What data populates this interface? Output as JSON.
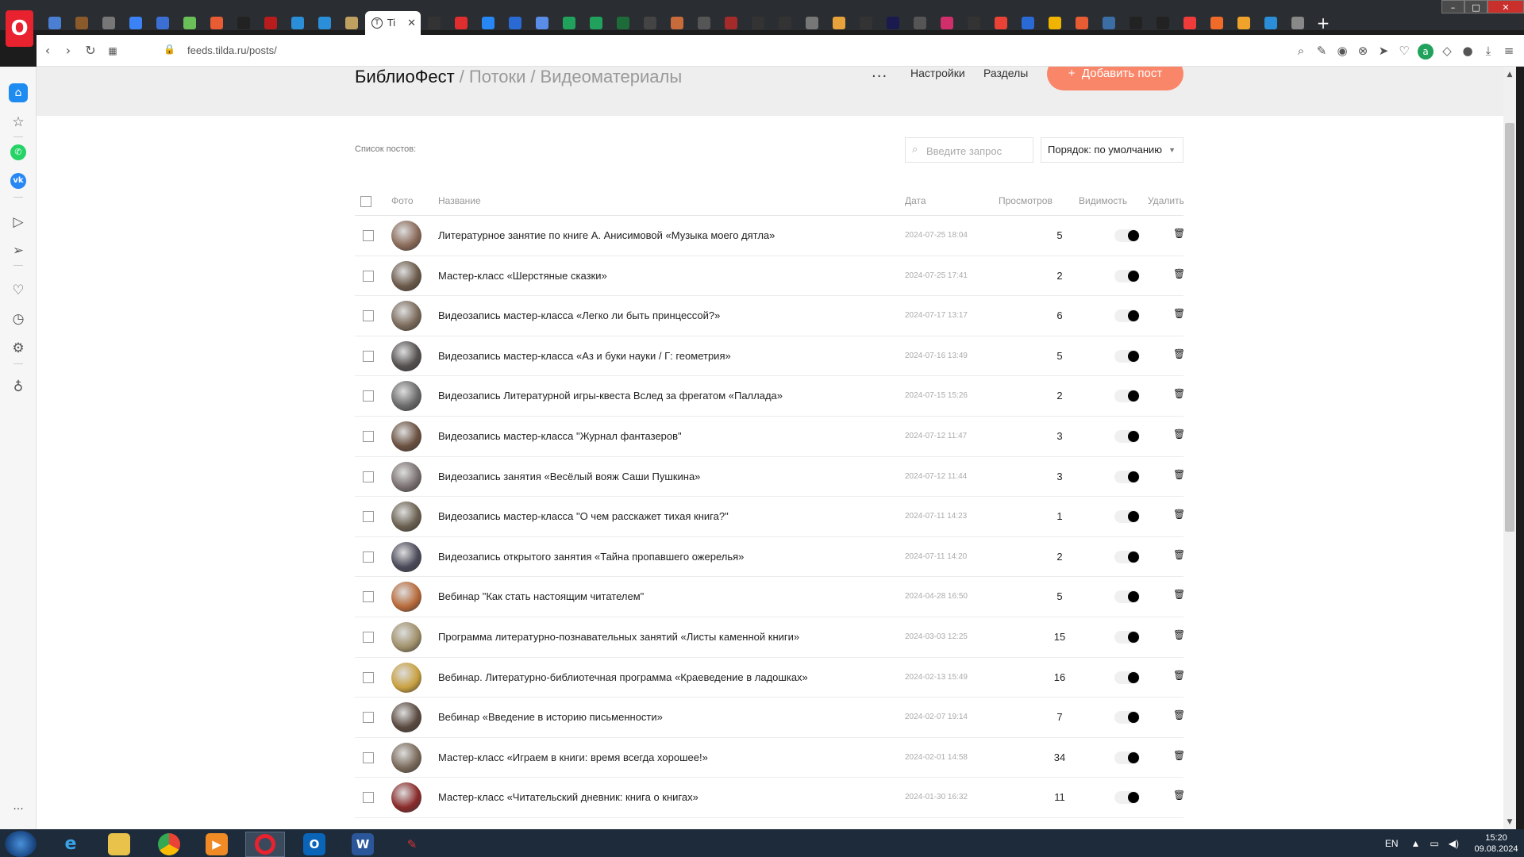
{
  "browser": {
    "active_tab": {
      "label": "Ti"
    },
    "url": "feeds.tilda.ru/posts/",
    "logo_letter": "O"
  },
  "tabs_icons": [
    {
      "name": "tab-1-icon",
      "color": "#4a7fd4"
    },
    {
      "name": "tab-2-icon",
      "color": "#8a5a2b"
    },
    {
      "name": "tab-3-icon",
      "color": "#777777"
    },
    {
      "name": "tab-4-icon",
      "color": "#3b82f6"
    },
    {
      "name": "tab-5-icon",
      "color": "#3b6fd4"
    },
    {
      "name": "tab-6-icon",
      "color": "#6bbf59"
    },
    {
      "name": "tab-7-icon",
      "color": "#e85c33"
    },
    {
      "name": "tab-8-icon",
      "color": "#222222"
    },
    {
      "name": "tab-9-icon",
      "color": "#b91c1c"
    },
    {
      "name": "tab-10-icon",
      "color": "#2a8fd8"
    },
    {
      "name": "tab-11-icon",
      "color": "#2a8fd8"
    },
    {
      "name": "tab-12-icon",
      "color": "#c0a060"
    }
  ],
  "tabs_icons_right": [
    {
      "name": "tab-14-icon",
      "color": "#333333"
    },
    {
      "name": "tab-15-icon",
      "color": "#e02d2d"
    },
    {
      "name": "tab-16-icon",
      "color": "#2787f5"
    },
    {
      "name": "tab-17-icon",
      "color": "#2a6ad4"
    },
    {
      "name": "tab-18-icon",
      "color": "#5a8de8"
    },
    {
      "name": "tab-19-icon",
      "color": "#21a25c"
    },
    {
      "name": "tab-20-icon",
      "color": "#21a25c"
    },
    {
      "name": "tab-21-icon",
      "color": "#1e6b3a"
    },
    {
      "name": "tab-22-icon",
      "color": "#444444"
    },
    {
      "name": "tab-23-icon",
      "color": "#c86b3b"
    },
    {
      "name": "tab-24-icon",
      "color": "#555555"
    },
    {
      "name": "tab-25-icon",
      "color": "#a52a2a"
    },
    {
      "name": "tab-26-icon",
      "color": "#333333"
    },
    {
      "name": "tab-27-icon",
      "color": "#333333"
    },
    {
      "name": "tab-28-icon",
      "color": "#777777"
    },
    {
      "name": "tab-29-icon",
      "color": "#e8a23b"
    },
    {
      "name": "tab-30-icon",
      "color": "#333333"
    },
    {
      "name": "tab-31-icon",
      "color": "#1a1a4e"
    },
    {
      "name": "tab-32-icon",
      "color": "#555555"
    },
    {
      "name": "tab-33-icon",
      "color": "#d12f6b"
    },
    {
      "name": "tab-34-icon",
      "color": "#333333"
    },
    {
      "name": "tab-35-icon",
      "color": "#ea4335"
    },
    {
      "name": "tab-36-icon",
      "color": "#2a6ad4"
    },
    {
      "name": "tab-37-icon",
      "color": "#f0b400"
    },
    {
      "name": "tab-38-icon",
      "color": "#e85c33"
    },
    {
      "name": "tab-39-icon",
      "color": "#3a6ea5"
    },
    {
      "name": "tab-40-icon",
      "color": "#222222"
    },
    {
      "name": "tab-41-icon",
      "color": "#222222"
    },
    {
      "name": "tab-42-icon",
      "color": "#f03b3b"
    },
    {
      "name": "tab-43-icon",
      "color": "#f06a2a"
    },
    {
      "name": "tab-44-icon",
      "color": "#f0a32a"
    },
    {
      "name": "tab-45-icon",
      "color": "#2a8fd8"
    },
    {
      "name": "tab-46-icon",
      "color": "#888888"
    }
  ],
  "page": {
    "breadcrumb": [
      "БиблиоФест",
      "Потоки",
      "Видеоматериалы"
    ],
    "settings_link": "Настройки",
    "sections_link": "Разделы",
    "add_button": "Добавить пост",
    "list_label": "Список постов:",
    "search_placeholder": "Введите запрос",
    "order_value": "Порядок: по умолчанию",
    "columns": {
      "photo": "Фото",
      "title": "Название",
      "date": "Дата",
      "views": "Просмотров",
      "visibility": "Видимость",
      "delete": "Удалить"
    }
  },
  "posts": [
    {
      "title": "Литературное занятие по книге А. Анисимовой «Музыка моего дятла»",
      "date": "2024-07-25 18:04",
      "views": "5",
      "thumb": "#8a6a58"
    },
    {
      "title": "Мастер-класс «Шерстяные сказки»",
      "date": "2024-07-25 17:41",
      "views": "2",
      "thumb": "#6b5a4a"
    },
    {
      "title": "Видеозапись мастер-класса «Легко ли быть принцессой?»",
      "date": "2024-07-17 13:17",
      "views": "6",
      "thumb": "#7a6a5a"
    },
    {
      "title": "Видеозапись мастер-класса «Аз и буки науки / Г: геометрия»",
      "date": "2024-07-16 13:49",
      "views": "5",
      "thumb": "#555050"
    },
    {
      "title": "Видеозапись Литературной игры-квеста Вслед за фрегатом «Паллада»",
      "date": "2024-07-15 15:26",
      "views": "2",
      "thumb": "#6a6a6a"
    },
    {
      "title": "Видеозапись мастер-класса \"Журнал фантазеров\"",
      "date": "2024-07-12 11:47",
      "views": "3",
      "thumb": "#6a5040"
    },
    {
      "title": "Видеозапись занятия «Весёлый вояж Саши Пушкина»",
      "date": "2024-07-12 11:44",
      "views": "3",
      "thumb": "#7a7070"
    },
    {
      "title": "Видеозапись мастер-класса \"О чем расскажет тихая книга?\"",
      "date": "2024-07-11 14:23",
      "views": "1",
      "thumb": "#6a6050"
    },
    {
      "title": "Видеозапись открытого занятия «Тайна пропавшего ожерелья»",
      "date": "2024-07-11 14:20",
      "views": "2",
      "thumb": "#4a4a5a"
    },
    {
      "title": "Вебинар \"Как стать настоящим читателем\"",
      "date": "2024-04-28 16:50",
      "views": "5",
      "thumb": "#b86a3a"
    },
    {
      "title": "Программа литературно-познавательных занятий «Листы каменной книги»",
      "date": "2024-03-03 12:25",
      "views": "15",
      "thumb": "#a0906a"
    },
    {
      "title": "Вебинар. Литературно-библиотечная программа «Краеведение в ладошках»",
      "date": "2024-02-13 15:49",
      "views": "16",
      "thumb": "#c8a040"
    },
    {
      "title": "Вебинар «Введение в историю письменности»",
      "date": "2024-02-07 19:14",
      "views": "7",
      "thumb": "#5a4a40"
    },
    {
      "title": "Мастер-класс «Играем в книги: время всегда хорошее!»",
      "date": "2024-02-01 14:58",
      "views": "34",
      "thumb": "#7a6a5a"
    },
    {
      "title": "Мастер-класс «Читательский дневник: книга о книгах»",
      "date": "2024-01-30 16:32",
      "views": "11",
      "thumb": "#8a2a2a"
    }
  ],
  "taskbar": {
    "lang": "EN",
    "time": "15:20",
    "date": "09.08.2024"
  },
  "colors": {
    "accent": "#fa8669",
    "opera": "#e8222e"
  }
}
